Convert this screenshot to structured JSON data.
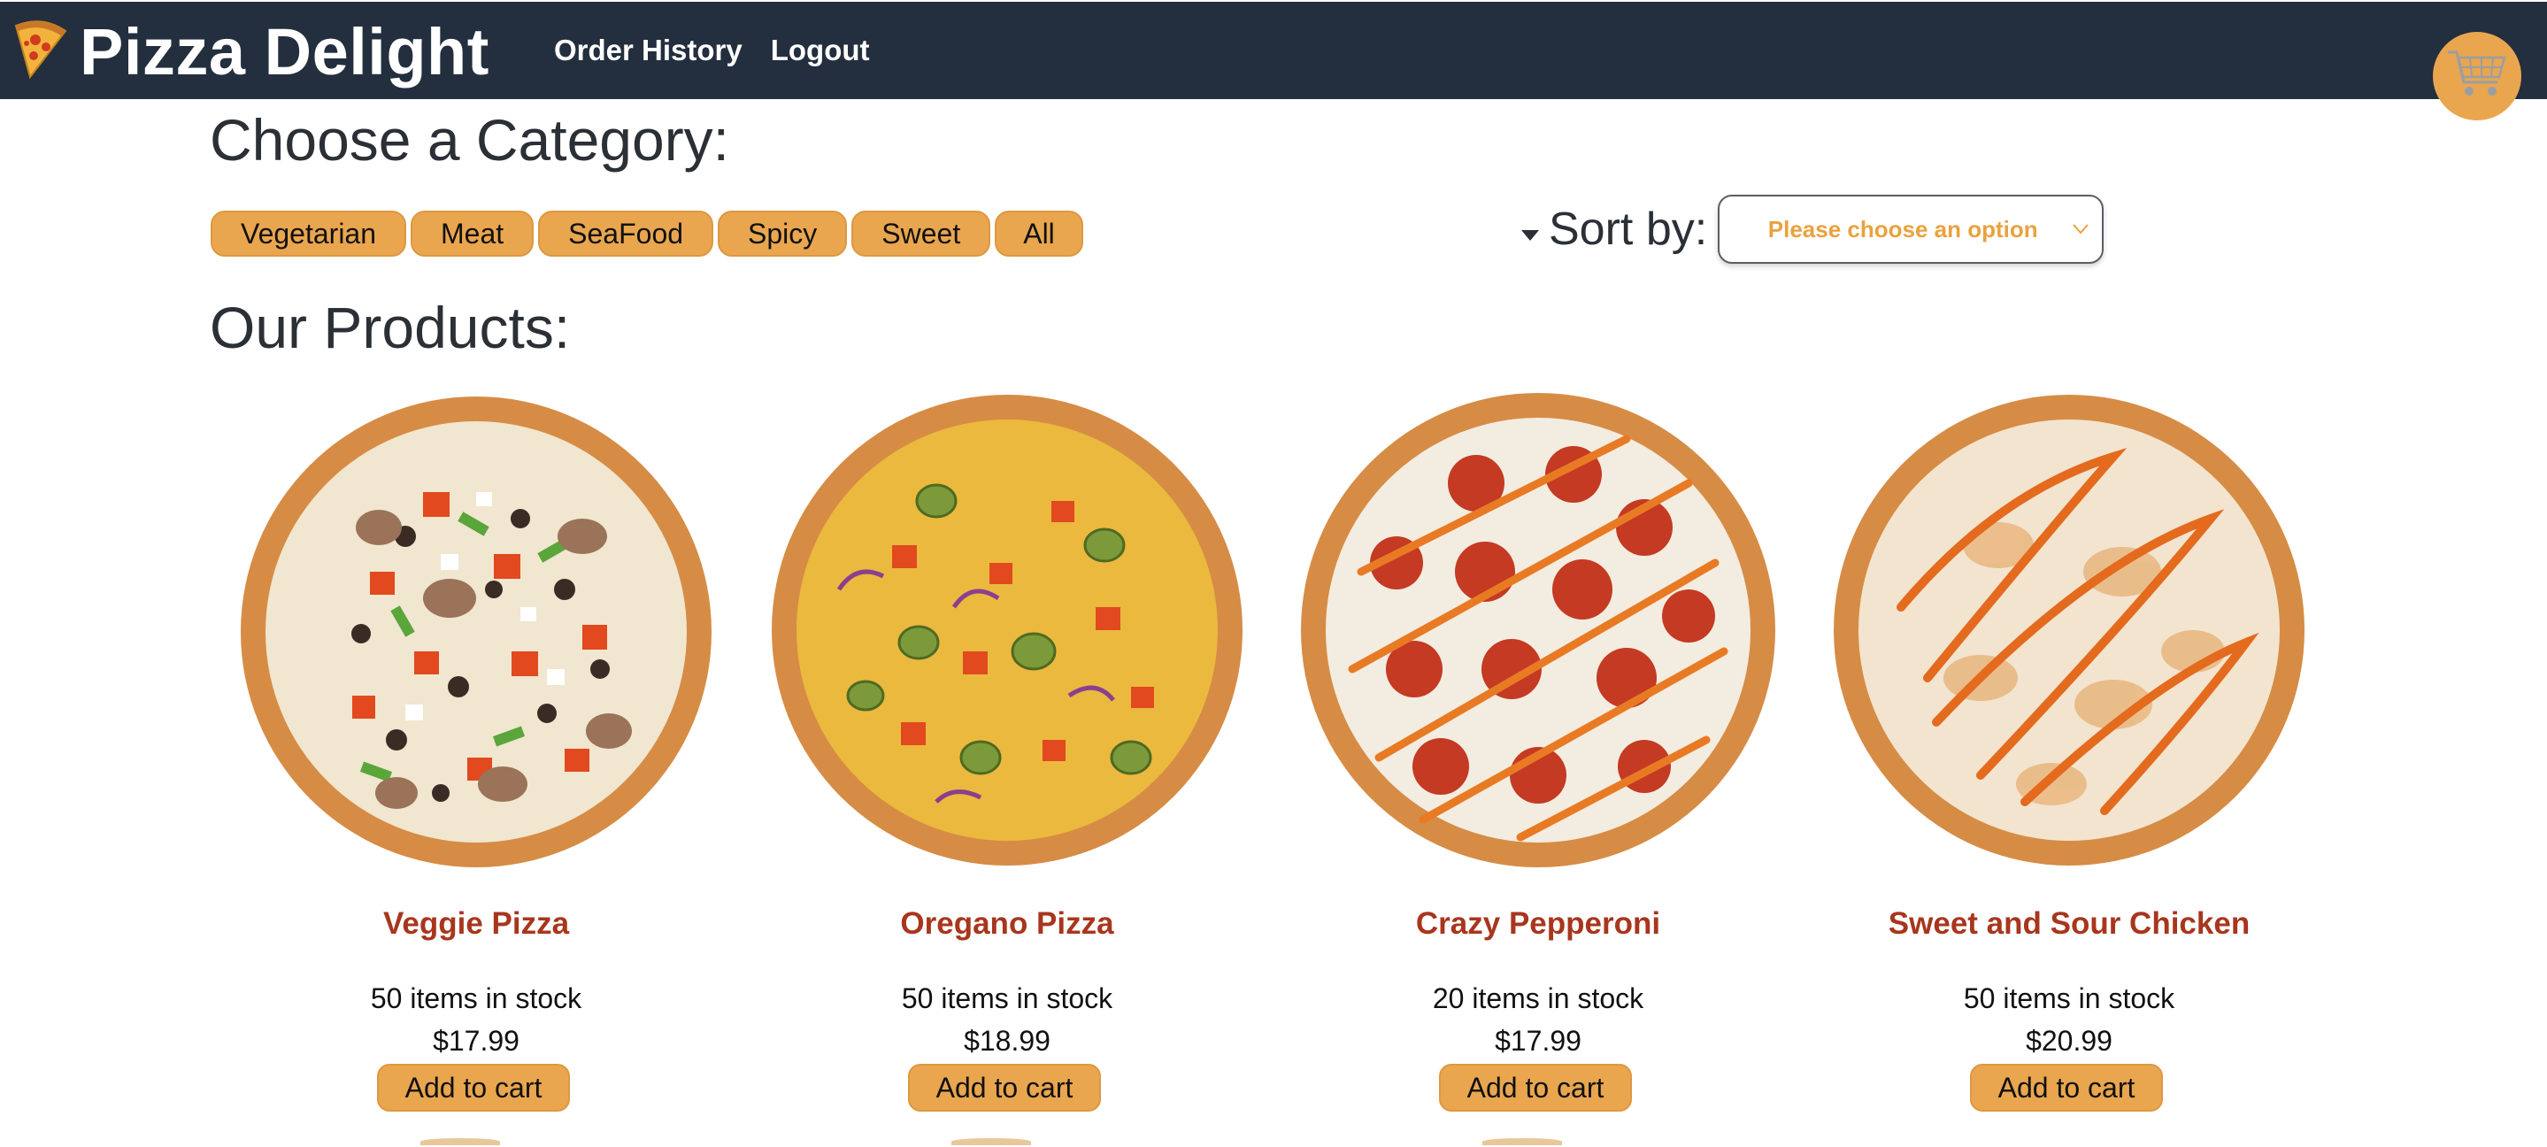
{
  "navbar": {
    "brand_icon": "pizza-slice-icon",
    "brand_name": "Pizza Delight",
    "links": [
      "Order History",
      "Logout"
    ],
    "cart_icon": "shopping-cart-icon",
    "background": "#232f3e"
  },
  "categories": {
    "heading": "Choose a Category:",
    "items": [
      "Vegetarian",
      "Meat",
      "SeaFood",
      "Spicy",
      "Sweet",
      "All"
    ]
  },
  "sort": {
    "caret_icon": "caret-down-icon",
    "label": "Sort by:",
    "placeholder": "Please choose an option",
    "chevron_icon": "chevron-down-icon"
  },
  "products": {
    "heading": "Our Products:",
    "add_label": "Add to cart",
    "items": [
      {
        "name": "Veggie Pizza",
        "stock": "50 items in stock",
        "price": "$17.99"
      },
      {
        "name": "Oregano Pizza",
        "stock": "50 items in stock",
        "price": "$18.99"
      },
      {
        "name": "Crazy Pepperoni",
        "stock": "20 items in stock",
        "price": "$17.99"
      },
      {
        "name": "Sweet and Sour Chicken",
        "stock": "50 items in stock",
        "price": "$20.99"
      }
    ]
  },
  "colors": {
    "accent": "#e9a64f",
    "product_name": "#a8361d",
    "heading": "#2b2f36"
  }
}
